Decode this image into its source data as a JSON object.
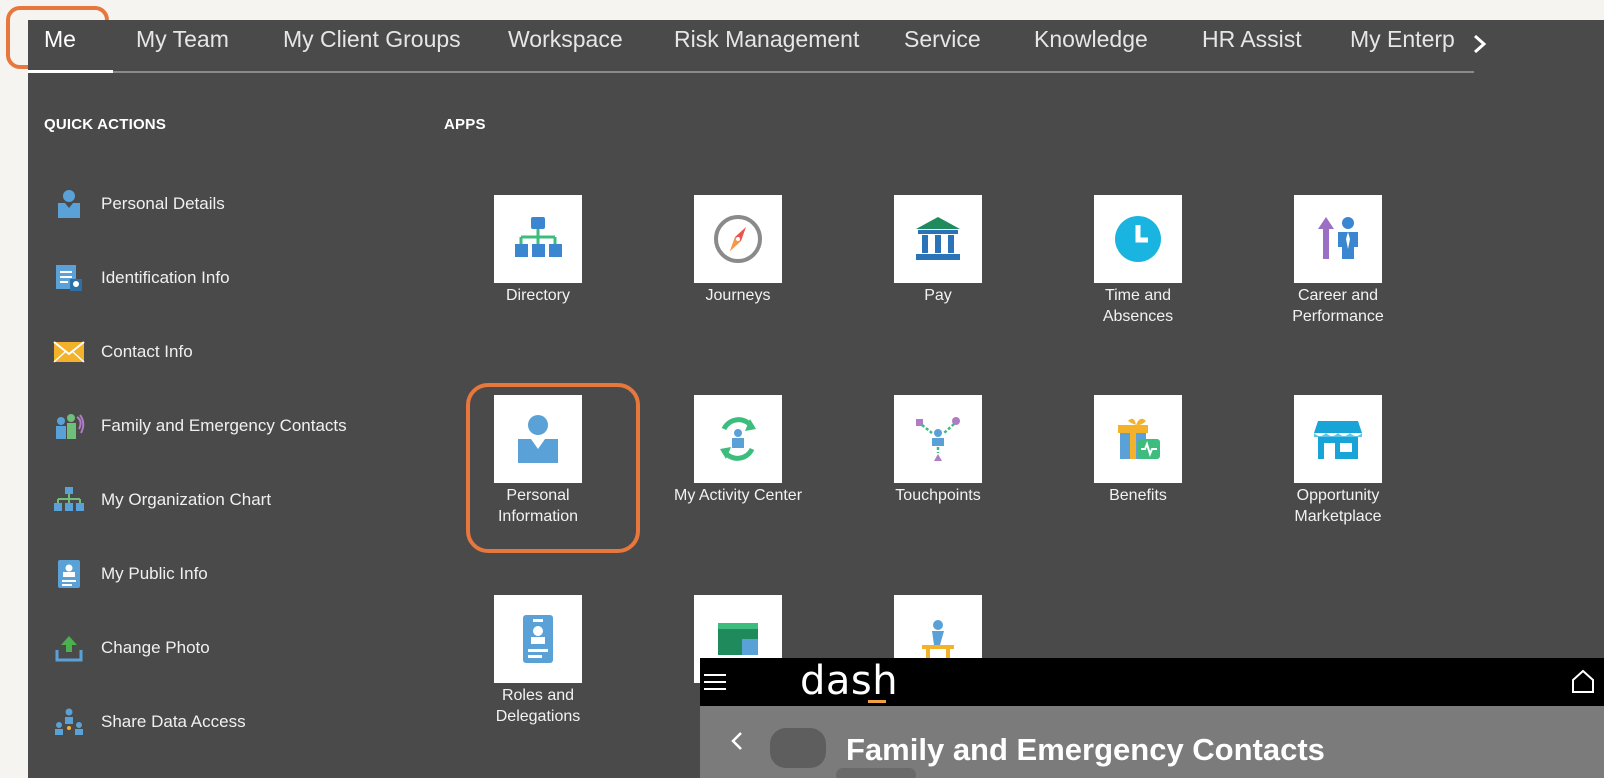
{
  "nav": {
    "tabs": [
      {
        "label": "Me"
      },
      {
        "label": "My Team"
      },
      {
        "label": "My Client Groups"
      },
      {
        "label": "Workspace"
      },
      {
        "label": "Risk Management"
      },
      {
        "label": "Service"
      },
      {
        "label": "Knowledge"
      },
      {
        "label": "HR Assist"
      },
      {
        "label": "My Enterp"
      }
    ],
    "next_icon": "chevron-right-icon"
  },
  "quick_actions": {
    "heading": "QUICK ACTIONS",
    "items": [
      {
        "label": "Personal Details",
        "icon": "person-icon"
      },
      {
        "label": "Identification Info",
        "icon": "id-document-icon"
      },
      {
        "label": "Contact Info",
        "icon": "envelope-icon"
      },
      {
        "label": "Family and Emergency Contacts",
        "icon": "family-icon"
      },
      {
        "label": "My Organization Chart",
        "icon": "org-chart-icon"
      },
      {
        "label": "My Public Info",
        "icon": "badge-icon"
      },
      {
        "label": "Change Photo",
        "icon": "upload-icon"
      },
      {
        "label": "Share Data Access",
        "icon": "share-people-icon"
      }
    ]
  },
  "apps": {
    "heading": "APPS",
    "items": [
      {
        "label": "Directory",
        "icon": "org-chart-icon"
      },
      {
        "label": "Journeys",
        "icon": "compass-icon"
      },
      {
        "label": "Pay",
        "icon": "bank-icon"
      },
      {
        "label": "Time and\nAbsences",
        "icon": "clock-icon"
      },
      {
        "label": "Career and\nPerformance",
        "icon": "career-growth-icon"
      },
      {
        "label": "Personal\nInformation",
        "icon": "person-icon"
      },
      {
        "label": "My Activity Center",
        "icon": "activity-cycle-icon"
      },
      {
        "label": "Touchpoints",
        "icon": "touchpoints-icon"
      },
      {
        "label": "Benefits",
        "icon": "gift-icon"
      },
      {
        "label": "Opportunity\nMarketplace",
        "icon": "store-icon"
      },
      {
        "label": "Roles and\nDelegations",
        "icon": "badge-icon"
      },
      {
        "label": "",
        "icon": "document-icon"
      },
      {
        "label": "",
        "icon": "learning-icon"
      }
    ]
  },
  "dash": {
    "logo": "dash",
    "title": "Family and Emergency Contacts",
    "menu_icon": "hamburger-icon",
    "home_icon": "home-icon",
    "back_icon": "chevron-left-icon"
  },
  "colors": {
    "panel": "#4a4a4a",
    "highlight": "#e7773c",
    "icon_blue": "#5aa1d8",
    "dash_bar": "#000000"
  }
}
